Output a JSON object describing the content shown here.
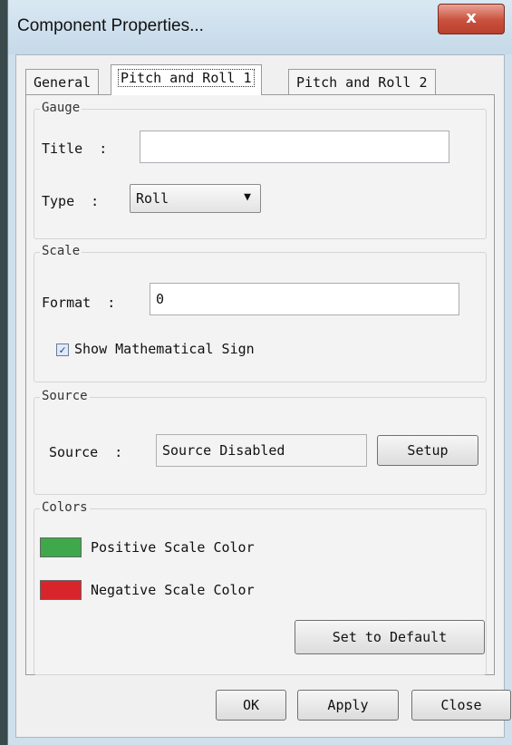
{
  "window": {
    "title": "Component Properties...",
    "close_glyph": "x"
  },
  "tabs": [
    {
      "label": "General"
    },
    {
      "label": "Pitch and Roll 1"
    },
    {
      "label": "Pitch and Roll 2"
    }
  ],
  "gauge": {
    "legend": "Gauge",
    "title_label": "Title  :",
    "title_value": "",
    "type_label": "Type  :",
    "type_value": "Roll"
  },
  "scale": {
    "legend": "Scale",
    "format_label": "Format  :",
    "format_value": "0",
    "show_sign_label": "Show Mathematical Sign",
    "show_sign_checked": true
  },
  "source": {
    "legend": "Source",
    "source_label": "Source  :",
    "source_value": "Source Disabled",
    "setup_button": "Setup"
  },
  "colors": {
    "legend": "Colors",
    "positive_label": "Positive Scale Color",
    "positive_color": "#3fa84a",
    "negative_label": "Negative Scale Color",
    "negative_color": "#d8252c",
    "default_button": "Set to Default"
  },
  "footer": {
    "ok": "OK",
    "apply": "Apply",
    "close": "Close"
  }
}
